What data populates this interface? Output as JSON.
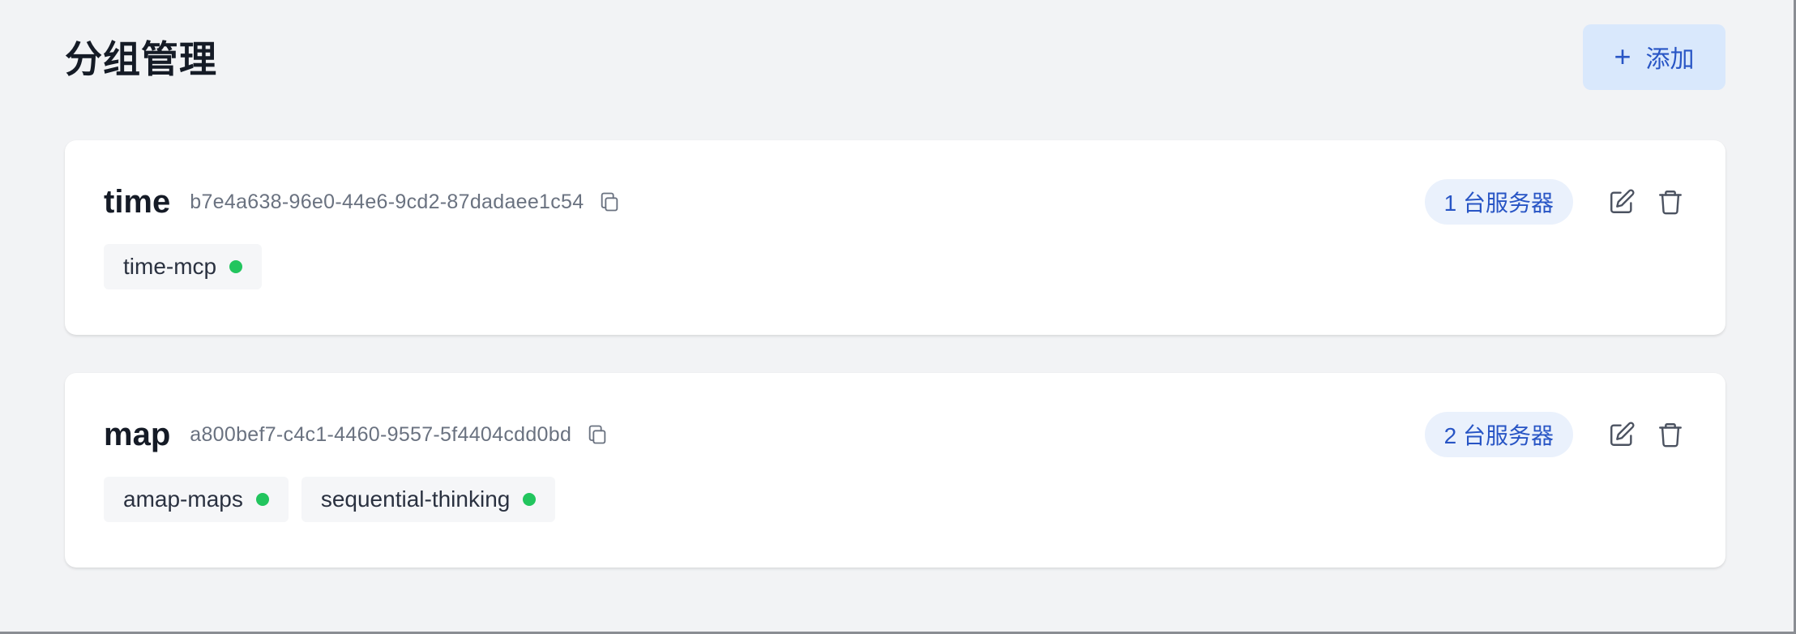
{
  "page": {
    "title": "分组管理",
    "add_button": {
      "icon": "plus-icon",
      "label": "添加"
    }
  },
  "groups": [
    {
      "name": "time",
      "id": "b7e4a638-96e0-44e6-9cd2-87dadaee1c54",
      "server_count_label": "1 台服务器",
      "servers": [
        {
          "name": "time-mcp",
          "status": "online"
        }
      ]
    },
    {
      "name": "map",
      "id": "a800bef7-c4c1-4460-9557-5f4404cdd0bd",
      "server_count_label": "2 台服务器",
      "servers": [
        {
          "name": "amap-maps",
          "status": "online"
        },
        {
          "name": "sequential-thinking",
          "status": "online"
        }
      ]
    }
  ],
  "colors": {
    "accent": "#2855c5",
    "status_online": "#22c55e",
    "background": "#f2f3f5"
  }
}
